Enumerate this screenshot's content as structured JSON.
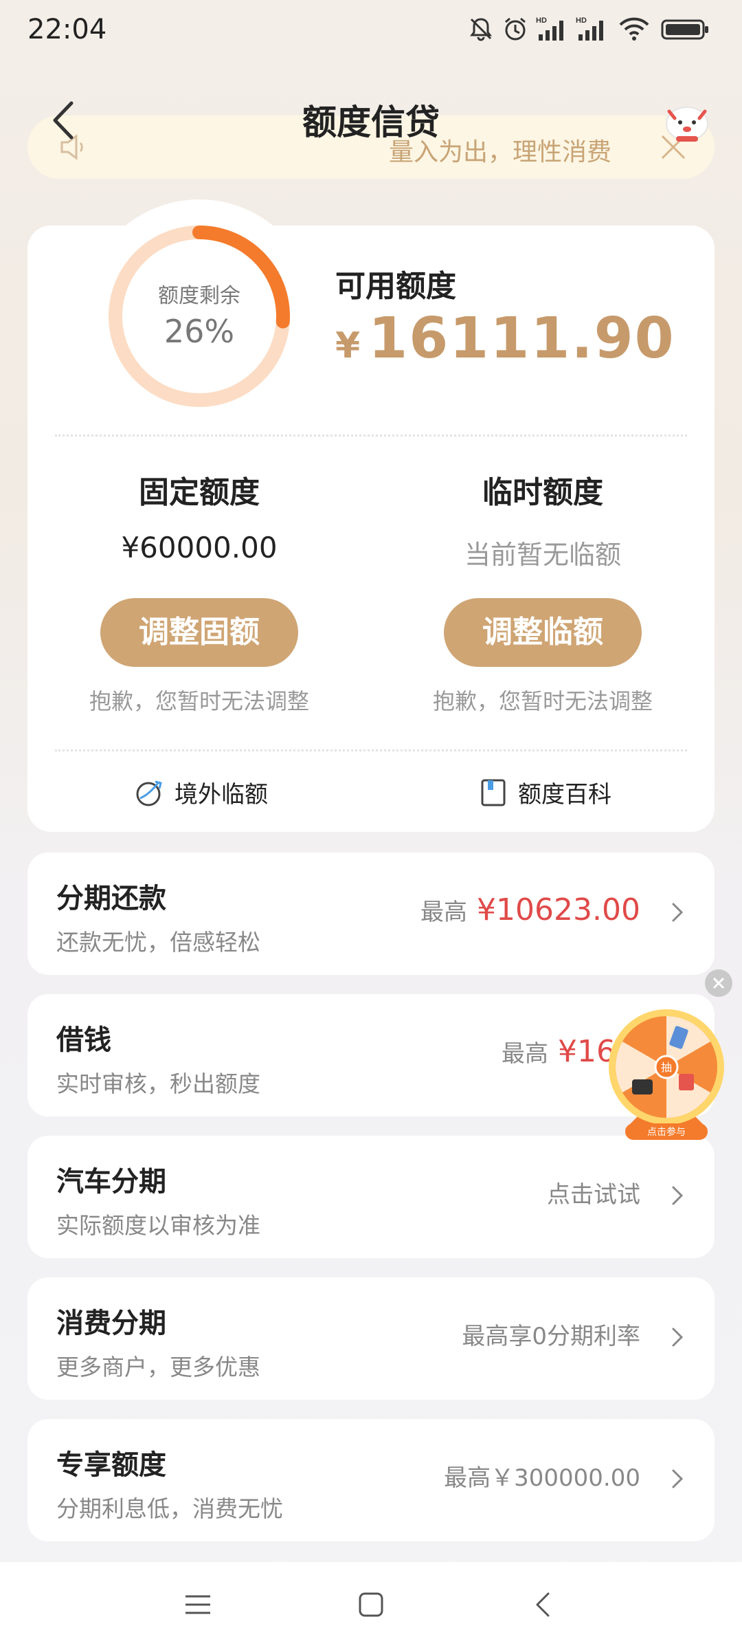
{
  "status_bar": {
    "time": "22:04",
    "icons": [
      "bell-off-icon",
      "alarm-icon",
      "signal-hd-icon",
      "signal-hd-icon",
      "wifi-icon",
      "battery-icon"
    ],
    "hd_label": "HD"
  },
  "header": {
    "title": "额度信贷",
    "back_icon": "chevron-left-icon",
    "mascot_icon": "mascot-icon"
  },
  "notice": {
    "text": "量入为出，理性消费",
    "speaker_icon": "speaker-icon",
    "close_icon": "close-icon"
  },
  "credit": {
    "ring_label": "额度剩余",
    "ring_percent_text": "26%",
    "ring_fraction": 0.26,
    "available_label": "可用额度",
    "available_currency": "¥",
    "available_amount": "16111.90",
    "fixed": {
      "title": "固定额度",
      "value": "¥60000.00",
      "button": "调整固额",
      "note": "抱歉，您暂时无法调整"
    },
    "temporary": {
      "title": "临时额度",
      "value": "当前暂无临额",
      "button": "调整临额",
      "note": "抱歉，您暂时无法调整"
    },
    "links": {
      "overseas": "境外临额",
      "encyclopedia": "额度百科"
    }
  },
  "list": [
    {
      "title": "分期还款",
      "subtitle": "还款无忧，倍感轻松",
      "right_prefix": "最高",
      "right_amount": "¥10623.00",
      "right_text": ""
    },
    {
      "title": "借钱",
      "subtitle": "实时审核，秒出额度",
      "right_prefix": "最高",
      "right_amount": "¥161",
      "right_text": ""
    },
    {
      "title": "汽车分期",
      "subtitle": "实际额度以审核为准",
      "right_prefix": "",
      "right_amount": "",
      "right_text": "点击试试"
    },
    {
      "title": "消费分期",
      "subtitle": "更多商户，更多优惠",
      "right_prefix": "",
      "right_amount": "",
      "right_text": "最高享0分期利率"
    },
    {
      "title": "专享额度",
      "subtitle": "分期利息低，消费无忧",
      "right_prefix": "",
      "right_amount": "",
      "right_text": "最高￥300000.00"
    }
  ],
  "wheel": {
    "center_label": "抽",
    "banner": "点击参与"
  },
  "bottom_nav": {
    "icons": [
      "menu-icon",
      "home-icon",
      "back-icon"
    ]
  },
  "colors": {
    "accent": "#cfa574",
    "amount_gold": "#c79a6b",
    "ring_active": "#f47b2c",
    "ring_track": "#fcdcc4",
    "highlight_red": "#e04a48"
  }
}
